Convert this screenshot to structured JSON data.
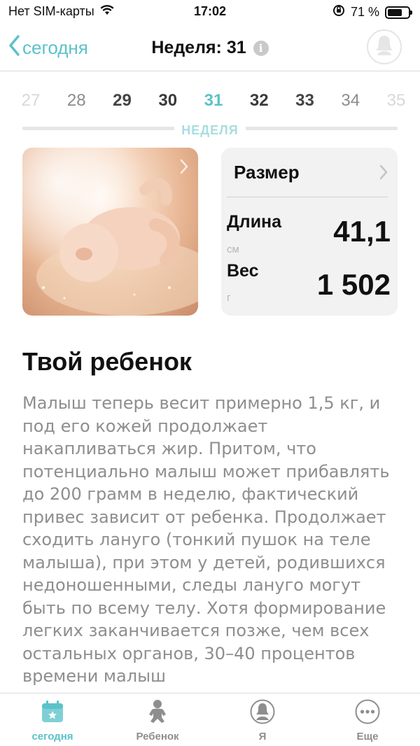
{
  "status_bar": {
    "carrier": "Нет SIM-карты",
    "time": "17:02",
    "battery": "71 %",
    "battery_level": 0.71
  },
  "nav": {
    "back_label": "сегодня",
    "title": "Неделя: 31"
  },
  "weeks": {
    "items": [
      "27",
      "28",
      "29",
      "30",
      "31",
      "32",
      "33",
      "34",
      "35"
    ],
    "selected": "31",
    "label": "НЕДЕЛЯ"
  },
  "size_card": {
    "title": "Размер",
    "length_label": "Длина",
    "length_unit": "см",
    "length_value": "41,1",
    "weight_label": "Вес",
    "weight_unit": "г",
    "weight_value": "1 502"
  },
  "content": {
    "title": "Твой ребенок",
    "body": "Малыш теперь весит примерно 1,5 кг, и под его кожей продолжает накапливаться жир. Притом, что потенциально малыш может прибавлять до 200 грамм в неделю, фактический привес зависит от ребенка. Продолжает сходить лануго (тонкий пушок на теле малыша), при этом у детей, родившихся недоношенными, следы лануго могут быть по всему телу. Хотя формирование легких заканчивается позже, чем всех остальных органов, 30–40 процентов времени малыш"
  },
  "tabs": [
    {
      "label": "сегодня",
      "icon": "calendar-icon",
      "active": true
    },
    {
      "label": "Ребенок",
      "icon": "baby-icon",
      "active": false
    },
    {
      "label": "Я",
      "icon": "person-icon",
      "active": false
    },
    {
      "label": "Еще",
      "icon": "more-icon",
      "active": false
    }
  ],
  "colors": {
    "accent": "#5bc2c9",
    "text_muted": "#8e8e8e",
    "card_bg": "#f2f2f2"
  }
}
